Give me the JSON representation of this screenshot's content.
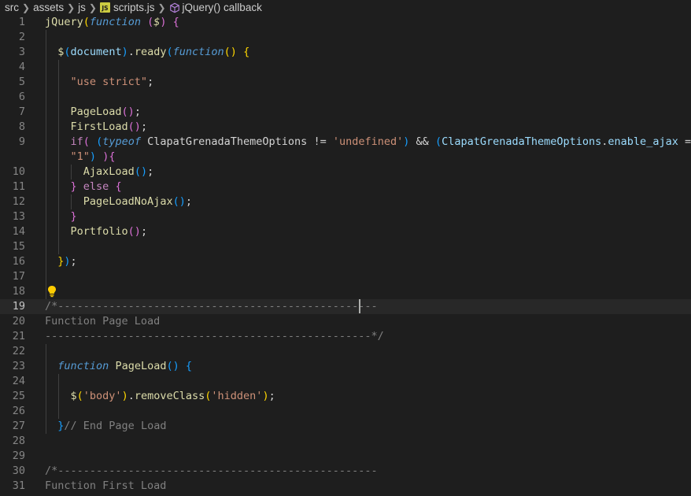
{
  "breadcrumb": {
    "items": [
      "src",
      "assets",
      "js",
      "scripts.js",
      "jQuery() callback"
    ],
    "file_badge": "JS"
  },
  "editor": {
    "current_line": 19,
    "lines": [
      {
        "n": "1",
        "tokens": [
          [
            "fn",
            "jQuery"
          ],
          [
            "p1",
            "("
          ],
          [
            "kw",
            "function"
          ],
          [
            "plain",
            " "
          ],
          [
            "p2",
            "("
          ],
          [
            "fn ital",
            "$"
          ],
          [
            "p2",
            ")"
          ],
          [
            "plain",
            " "
          ],
          [
            "p2",
            "{"
          ]
        ]
      },
      {
        "n": "2",
        "tokens": []
      },
      {
        "n": "3",
        "tokens": [
          [
            "plain",
            "  "
          ],
          [
            "fn",
            "$"
          ],
          [
            "p3",
            "("
          ],
          [
            "var",
            "document"
          ],
          [
            "p3",
            ")"
          ],
          [
            "plain",
            "."
          ],
          [
            "fn",
            "ready"
          ],
          [
            "p3",
            "("
          ],
          [
            "kw",
            "function"
          ],
          [
            "p1",
            "()"
          ],
          [
            "plain",
            " "
          ],
          [
            "p1",
            "{"
          ]
        ]
      },
      {
        "n": "4",
        "tokens": []
      },
      {
        "n": "5",
        "tokens": [
          [
            "plain",
            "    "
          ],
          [
            "str",
            "\"use strict\""
          ],
          [
            "sc",
            ";"
          ]
        ]
      },
      {
        "n": "6",
        "tokens": []
      },
      {
        "n": "7",
        "tokens": [
          [
            "plain",
            "    "
          ],
          [
            "fn",
            "PageLoad"
          ],
          [
            "p2",
            "()"
          ],
          [
            "sc",
            ";"
          ]
        ]
      },
      {
        "n": "8",
        "tokens": [
          [
            "plain",
            "    "
          ],
          [
            "fn",
            "FirstLoad"
          ],
          [
            "p2",
            "()"
          ],
          [
            "sc",
            ";"
          ]
        ]
      },
      {
        "n": "9",
        "tokens": [
          [
            "plain",
            "    "
          ],
          [
            "ctl",
            "if"
          ],
          [
            "p2",
            "("
          ],
          [
            "plain",
            " "
          ],
          [
            "p3",
            "("
          ],
          [
            "kw",
            "typeof"
          ],
          [
            "plain",
            " ClapatGrenadaThemeOptions "
          ],
          [
            "plain",
            "!="
          ],
          [
            "plain",
            " "
          ],
          [
            "str",
            "'undefined'"
          ],
          [
            "p3",
            ")"
          ],
          [
            "plain",
            " "
          ],
          [
            "plain",
            "&&"
          ],
          [
            "plain",
            " "
          ],
          [
            "p3",
            "("
          ],
          [
            "var",
            "ClapatGrenadaThemeOptions"
          ],
          [
            "plain",
            "."
          ],
          [
            "var",
            "enable_ajax"
          ],
          [
            "plain",
            " =="
          ]
        ]
      },
      {
        "n": "",
        "tokens": [
          [
            "plain",
            "    "
          ],
          [
            "str",
            "\"1\""
          ],
          [
            "p3",
            ")"
          ],
          [
            "plain",
            " "
          ],
          [
            "p2",
            ")"
          ],
          [
            "p2",
            "{"
          ]
        ]
      },
      {
        "n": "10",
        "tokens": [
          [
            "plain",
            "      "
          ],
          [
            "fn",
            "AjaxLoad"
          ],
          [
            "p3",
            "()"
          ],
          [
            "sc",
            ";"
          ]
        ]
      },
      {
        "n": "11",
        "tokens": [
          [
            "plain",
            "    "
          ],
          [
            "p2",
            "}"
          ],
          [
            "plain",
            " "
          ],
          [
            "ctl",
            "else"
          ],
          [
            "plain",
            " "
          ],
          [
            "p2",
            "{"
          ]
        ]
      },
      {
        "n": "12",
        "tokens": [
          [
            "plain",
            "      "
          ],
          [
            "fn",
            "PageLoadNoAjax"
          ],
          [
            "p3",
            "()"
          ],
          [
            "sc",
            ";"
          ]
        ]
      },
      {
        "n": "13",
        "tokens": [
          [
            "plain",
            "    "
          ],
          [
            "p2",
            "}"
          ]
        ]
      },
      {
        "n": "14",
        "tokens": [
          [
            "plain",
            "    "
          ],
          [
            "fn",
            "Portfolio"
          ],
          [
            "p2",
            "()"
          ],
          [
            "sc",
            ";"
          ]
        ]
      },
      {
        "n": "15",
        "tokens": []
      },
      {
        "n": "16",
        "tokens": [
          [
            "plain",
            "  "
          ],
          [
            "p1",
            "}"
          ],
          [
            "p3",
            ")"
          ],
          [
            "sc",
            ";"
          ]
        ]
      },
      {
        "n": "17",
        "tokens": []
      },
      {
        "n": "18",
        "tokens": []
      },
      {
        "n": "19",
        "tokens": [
          [
            "cmg",
            "/*--------------------------------------------------"
          ]
        ]
      },
      {
        "n": "20",
        "tokens": [
          [
            "cmg",
            "Function Page Load"
          ]
        ]
      },
      {
        "n": "21",
        "tokens": [
          [
            "cmg",
            "---------------------------------------------------*/"
          ]
        ]
      },
      {
        "n": "22",
        "tokens": []
      },
      {
        "n": "23",
        "tokens": [
          [
            "plain",
            "  "
          ],
          [
            "kw",
            "function"
          ],
          [
            "plain",
            " "
          ],
          [
            "fn",
            "PageLoad"
          ],
          [
            "p3",
            "()"
          ],
          [
            "plain",
            " "
          ],
          [
            "p3",
            "{"
          ]
        ]
      },
      {
        "n": "24",
        "tokens": []
      },
      {
        "n": "25",
        "tokens": [
          [
            "plain",
            "    "
          ],
          [
            "fn",
            "$"
          ],
          [
            "p1",
            "("
          ],
          [
            "str",
            "'body'"
          ],
          [
            "p1",
            ")"
          ],
          [
            "plain",
            "."
          ],
          [
            "fn",
            "removeClass"
          ],
          [
            "p1",
            "("
          ],
          [
            "str",
            "'hidden'"
          ],
          [
            "p1",
            ")"
          ],
          [
            "sc",
            ";"
          ]
        ]
      },
      {
        "n": "26",
        "tokens": []
      },
      {
        "n": "27",
        "tokens": [
          [
            "plain",
            "  "
          ],
          [
            "p3",
            "}"
          ],
          [
            "cmg",
            "// End Page Load"
          ]
        ]
      },
      {
        "n": "28",
        "tokens": []
      },
      {
        "n": "29",
        "tokens": []
      },
      {
        "n": "30",
        "tokens": [
          [
            "cmg",
            "/*--------------------------------------------------"
          ]
        ]
      },
      {
        "n": "31",
        "tokens": [
          [
            "cmg",
            "Function First Load"
          ]
        ]
      }
    ]
  }
}
